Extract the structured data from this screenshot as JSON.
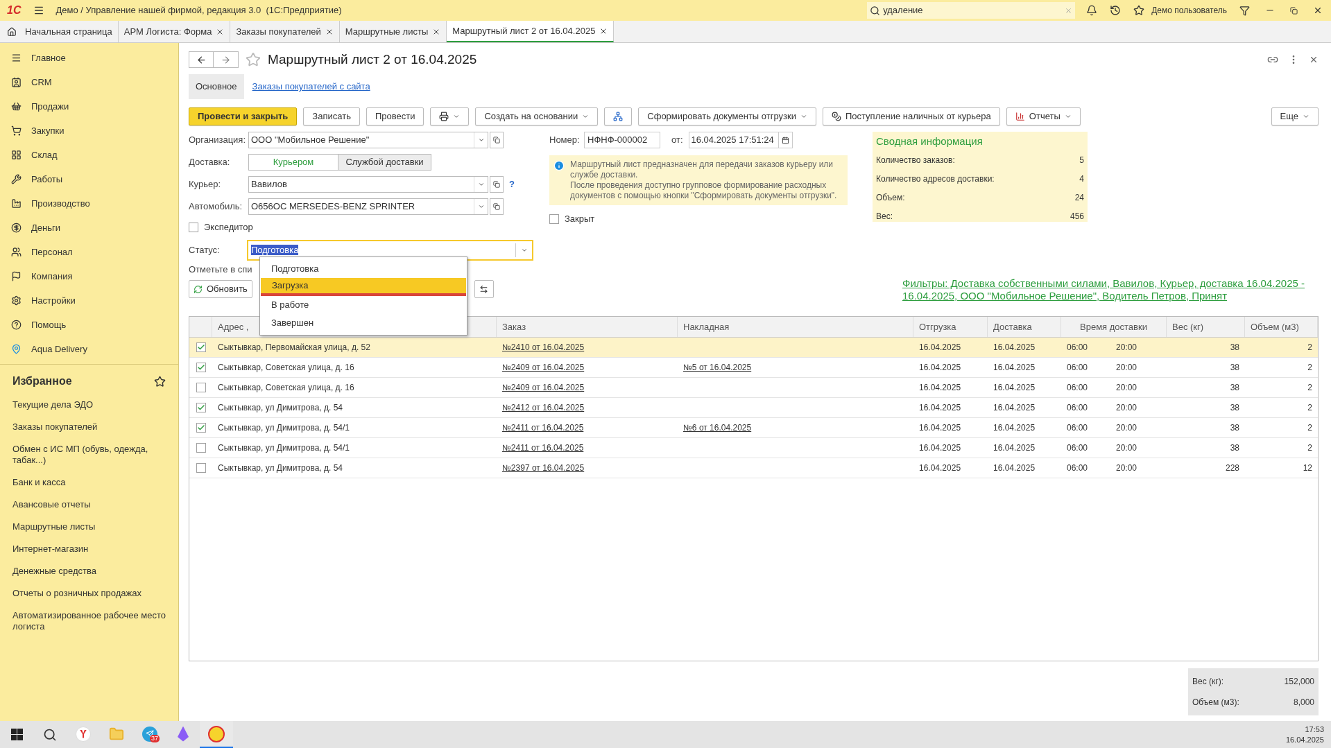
{
  "window": {
    "title": "Демо / Управление нашей фирмой, редакция 3.0  (1С:Предприятие)",
    "logo": "1С",
    "search": "удаление",
    "user": "Демо пользователь"
  },
  "tabs": [
    {
      "label": "Начальная страница",
      "kind": "home",
      "selected": false
    },
    {
      "label": "АРМ Логиста: Форма",
      "kind": "doc",
      "selected": false
    },
    {
      "label": "Заказы покупателей",
      "kind": "doc",
      "selected": false
    },
    {
      "label": "Маршрутные листы",
      "kind": "doc",
      "selected": false
    },
    {
      "label": "Маршрутный лист 2 от 16.04.2025",
      "kind": "doc",
      "selected": true
    }
  ],
  "sidebar": {
    "items": [
      "Главное",
      "CRM",
      "Продажи",
      "Закупки",
      "Склад",
      "Работы",
      "Производство",
      "Деньги",
      "Персонал",
      "Компания",
      "Настройки",
      "Помощь",
      "Aqua Delivery"
    ],
    "favorites_title": "Избранное",
    "favorites": [
      "Текущие дела ЭДО",
      "Заказы покупателей",
      "Обмен с ИС МП (обувь, одежда, табак...)",
      "Банк и касса",
      "Авансовые отчеты",
      "Маршрутные листы",
      "Интернет-магазин",
      "Денежные средства",
      "Отчеты о розничных продажах",
      "Автоматизированное рабочее место логиста"
    ]
  },
  "form": {
    "title": "Маршрутный лист 2 от 16.04.2025",
    "subtabs": [
      {
        "label": "Основное",
        "selected": true
      },
      {
        "label": "Заказы покупателей с сайта",
        "selected": false
      }
    ],
    "toolbar": [
      {
        "label": "Провести и закрыть",
        "kind": "primary"
      },
      {
        "label": "Записать",
        "kind": "plain"
      },
      {
        "label": "Провести",
        "kind": "plain"
      },
      {
        "kind": "print"
      },
      {
        "label": "Создать на основании",
        "kind": "menu"
      },
      {
        "kind": "structure"
      },
      {
        "label": "Сформировать документы отгрузки",
        "kind": "menu"
      },
      {
        "label": "Поступление наличных от курьера",
        "kind": "cash"
      },
      {
        "label": "Отчеты",
        "kind": "report"
      }
    ],
    "more": "Еще",
    "organization": {
      "label": "Организация:",
      "value": "ООО \"Мобильное Решение\""
    },
    "delivery": {
      "label": "Доставка:",
      "options": [
        {
          "label": "Курьером",
          "selected": true
        },
        {
          "label": "Службой доставки",
          "selected": false
        }
      ]
    },
    "courier": {
      "label": "Курьер:",
      "value": "Вавилов",
      "help": "?"
    },
    "car": {
      "label": "Автомобиль:",
      "value": "О656ОС MERSEDES-BENZ SPRINTER"
    },
    "forwarder": {
      "label": "Экспедитор",
      "checked": false
    },
    "status": {
      "label": "Статус:",
      "value": "Подготовка",
      "options": [
        {
          "label": "Подготовка",
          "highlighted": false
        },
        {
          "label": "Загрузка",
          "highlighted": true
        },
        {
          "label": "В работе",
          "highlighted": false
        },
        {
          "label": "Завершен",
          "highlighted": false
        }
      ]
    },
    "hint": "Отметьте в спи",
    "refresh": "Обновить",
    "number": {
      "label": "Номер:",
      "value": "НФНФ-000002",
      "date_label": "от:",
      "date": "16.04.2025 17:51:24"
    },
    "info": "Маршрутный лист предназначен для передачи заказов курьеру или службе доставки.\nПосле проведения доступно групповое формирование расходных документов с помощью кнопки \"Сформировать документы отгрузки\".",
    "closed": {
      "label": "Закрыт",
      "checked": false
    },
    "summary": {
      "title": "Сводная информация",
      "rows": [
        {
          "label": "Количество заказов:",
          "value": "5"
        },
        {
          "label": "Количество адресов доставки:",
          "value": "4"
        },
        {
          "label": "Объем:",
          "value": "24"
        },
        {
          "label": "Вес:",
          "value": "456"
        }
      ]
    },
    "filters": "Фильтры: Доставка собственными силами, Вавилов, Курьер, доставка 16.04.2025 - 16.04.2025, ООО \"Мобильное Решение\", Водитель Петров, Принят"
  },
  "table": {
    "columns": [
      "Адрес ,",
      "Заказ",
      "Накладная",
      "Отгрузка",
      "Доставка",
      "Время доставки",
      "Вес (кг)",
      "Объем (м3)"
    ],
    "rows": [
      {
        "checked": true,
        "selected": true,
        "address": "Сыктывкар, Первомайская улица, д. 52",
        "order": "№2410 от 16.04.2025",
        "invoice": "",
        "ship": "16.04.2025",
        "delivery": "16.04.2025",
        "from": "06:00",
        "to": "20:00",
        "weight": "38",
        "volume": "2"
      },
      {
        "checked": true,
        "selected": false,
        "address": "Сыктывкар, Советская улица, д. 16",
        "order": "№2409 от 16.04.2025",
        "invoice": "№5 от 16.04.2025",
        "ship": "16.04.2025",
        "delivery": "16.04.2025",
        "from": "06:00",
        "to": "20:00",
        "weight": "38",
        "volume": "2"
      },
      {
        "checked": false,
        "selected": false,
        "address": "Сыктывкар, Советская улица, д. 16",
        "order": "№2409 от 16.04.2025",
        "invoice": "",
        "ship": "16.04.2025",
        "delivery": "16.04.2025",
        "from": "06:00",
        "to": "20:00",
        "weight": "38",
        "volume": "2"
      },
      {
        "checked": true,
        "selected": false,
        "address": "Сыктывкар, ул Димитрова, д. 54",
        "order": "№2412 от 16.04.2025",
        "invoice": "",
        "ship": "16.04.2025",
        "delivery": "16.04.2025",
        "from": "06:00",
        "to": "20:00",
        "weight": "38",
        "volume": "2"
      },
      {
        "checked": true,
        "selected": false,
        "address": "Сыктывкар, ул Димитрова, д. 54/1",
        "order": "№2411 от 16.04.2025",
        "invoice": "№6 от 16.04.2025",
        "ship": "16.04.2025",
        "delivery": "16.04.2025",
        "from": "06:00",
        "to": "20:00",
        "weight": "38",
        "volume": "2"
      },
      {
        "checked": false,
        "selected": false,
        "address": "Сыктывкар, ул Димитрова, д. 54/1",
        "order": "№2411 от 16.04.2025",
        "invoice": "",
        "ship": "16.04.2025",
        "delivery": "16.04.2025",
        "from": "06:00",
        "to": "20:00",
        "weight": "38",
        "volume": "2"
      },
      {
        "checked": false,
        "selected": false,
        "address": "Сыктывкар, ул Димитрова, д. 54",
        "order": "№2397 от 16.04.2025",
        "invoice": "",
        "ship": "16.04.2025",
        "delivery": "16.04.2025",
        "from": "06:00",
        "to": "20:00",
        "weight": "228",
        "volume": "12"
      }
    ]
  },
  "totals": [
    {
      "label": "Вес (кг):",
      "value": "152,000"
    },
    {
      "label": "Объем (м3):",
      "value": "8,000"
    }
  ],
  "taskbar": {
    "apps": [
      {
        "kind": "browser",
        "active": false
      },
      {
        "kind": "files",
        "active": false
      },
      {
        "kind": "telegram",
        "active": false,
        "badge": "37"
      },
      {
        "kind": "crystal",
        "active": false
      },
      {
        "kind": "onec",
        "active": true
      }
    ],
    "time": "17:53",
    "date": "16.04.2025"
  }
}
